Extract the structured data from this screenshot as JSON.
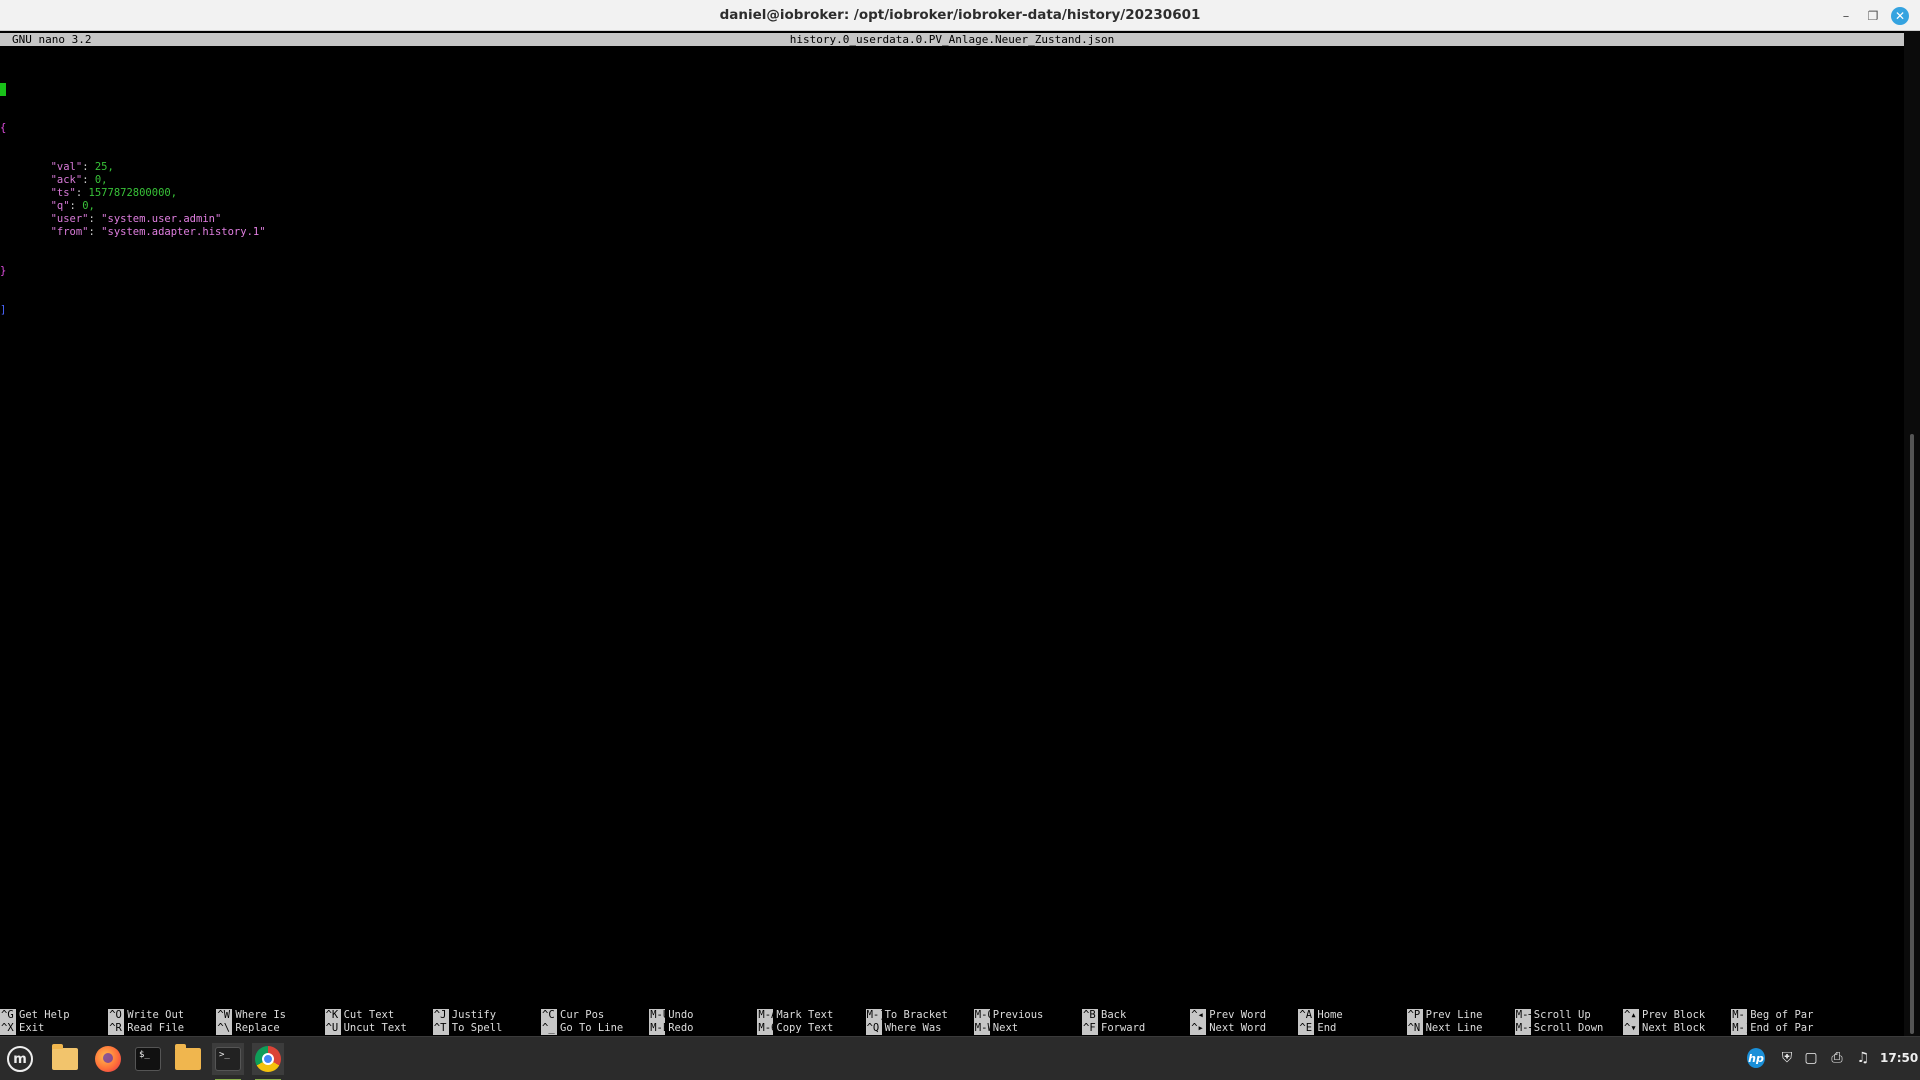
{
  "window": {
    "title": "daniel@iobroker: /opt/iobroker/iobroker-data/history/20230601",
    "controls": {
      "minimize": "–",
      "maximize": "❐",
      "close": "✕"
    }
  },
  "nano": {
    "version": "GNU nano 3.2",
    "filename": "history.0_userdata.0.PV_Anlage.Neuer_Zustand.json"
  },
  "file": {
    "open_bracket": "[",
    "open_brace": "{",
    "indent": "        ",
    "entries": [
      {
        "key": "\"val\"",
        "value": "25",
        "type": "num",
        "comma": ","
      },
      {
        "key": "\"ack\"",
        "value": "0",
        "type": "num",
        "comma": ","
      },
      {
        "key": "\"ts\"",
        "value": "1577872800000",
        "type": "num",
        "comma": ","
      },
      {
        "key": "\"q\"",
        "value": "0",
        "type": "num",
        "comma": ","
      },
      {
        "key": "\"user\"",
        "value": "\"system.user.admin\"",
        "type": "str",
        "comma": ""
      },
      {
        "key": "\"from\"",
        "value": "\"system.adapter.history.1\"",
        "type": "str",
        "comma": ""
      }
    ],
    "close_brace": "}",
    "close_bracket": "]"
  },
  "shortcuts": [
    [
      {
        "key": "^G",
        "label": "Get Help"
      },
      {
        "key": "^X",
        "label": "Exit"
      }
    ],
    [
      {
        "key": "^O",
        "label": "Write Out"
      },
      {
        "key": "^R",
        "label": "Read File"
      }
    ],
    [
      {
        "key": "^W",
        "label": "Where Is"
      },
      {
        "key": "^\\",
        "label": "Replace"
      }
    ],
    [
      {
        "key": "^K",
        "label": "Cut Text"
      },
      {
        "key": "^U",
        "label": "Uncut Text"
      }
    ],
    [
      {
        "key": "^J",
        "label": "Justify"
      },
      {
        "key": "^T",
        "label": "To Spell"
      }
    ],
    [
      {
        "key": "^C",
        "label": "Cur Pos"
      },
      {
        "key": "^_",
        "label": "Go To Line"
      }
    ],
    [
      {
        "key": "M-U",
        "label": "Undo"
      },
      {
        "key": "M-E",
        "label": "Redo"
      }
    ],
    [
      {
        "key": "M-A",
        "label": "Mark Text"
      },
      {
        "key": "M-6",
        "label": "Copy Text"
      }
    ],
    [
      {
        "key": "M-]",
        "label": "To Bracket"
      },
      {
        "key": "^Q",
        "label": "Where Was"
      }
    ],
    [
      {
        "key": "M-Q",
        "label": "Previous"
      },
      {
        "key": "M-W",
        "label": "Next"
      }
    ],
    [
      {
        "key": "^B",
        "label": "Back"
      },
      {
        "key": "^F",
        "label": "Forward"
      }
    ],
    [
      {
        "key": "^◂",
        "label": "Prev Word"
      },
      {
        "key": "^▸",
        "label": "Next Word"
      }
    ],
    [
      {
        "key": "^A",
        "label": "Home"
      },
      {
        "key": "^E",
        "label": "End"
      }
    ],
    [
      {
        "key": "^P",
        "label": "Prev Line"
      },
      {
        "key": "^N",
        "label": "Next Line"
      }
    ],
    [
      {
        "key": "M-─",
        "label": "Scroll Up"
      },
      {
        "key": "M-+",
        "label": "Scroll Down"
      }
    ],
    [
      {
        "key": "^▴",
        "label": "Prev Block"
      },
      {
        "key": "^▾",
        "label": "Next Block"
      }
    ],
    [
      {
        "key": "M-(",
        "label": "Beg of Par"
      },
      {
        "key": "M-)",
        "label": "End of Par"
      }
    ]
  ],
  "taskbar": {
    "menu_glyph": "m",
    "terminal_glyph": "$_",
    "terminal2_glyph": ">_",
    "hp_glyph": "hp",
    "clock": "17:50",
    "tray_icons": [
      "hp-icon",
      "shield-icon",
      "clipboard-icon",
      "printer-icon",
      "audio-icon"
    ]
  },
  "colors": {
    "key_color": "#d87ad8",
    "number_color": "#38c238",
    "string_color": "#e17fe1",
    "brace_color": "#e14ee1",
    "bracket_color": "#4a66ff",
    "cursor_color": "#19c119"
  }
}
